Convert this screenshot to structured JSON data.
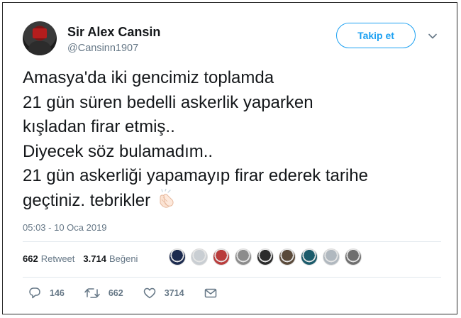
{
  "user": {
    "display_name": "Sir Alex Cansin",
    "handle": "@Cansinn1907"
  },
  "header": {
    "follow_label": "Takip et",
    "menu_icon": "chevron-down-icon"
  },
  "tweet": {
    "lines": [
      "Amasya'da iki gencimiz toplamda",
      "21 gün süren bedelli askerlik yaparken",
      "kışladan firar etmiş..",
      "Diyecek söz bulamadım..",
      "21 gün askerliği yapamayıp firar ederek tarihe",
      "geçtiniz. tebrikler"
    ],
    "emoji": "clapping-hands-icon",
    "timestamp": "05:03 - 10 Oca 2019"
  },
  "stats": {
    "retweet_count": "662",
    "retweet_label": "Retweet",
    "like_count": "3.714",
    "like_label": "Beğeni",
    "liker_colors": [
      "#1c2b4f",
      "#c9ced3",
      "#b93c3c",
      "#8c8c8c",
      "#2b2b2b",
      "#5a4a3a",
      "#1b5b6b",
      "#b0b8bf",
      "#6f6f6f"
    ]
  },
  "actions": {
    "reply_count": "146",
    "retweet_count": "662",
    "like_count": "3714"
  },
  "colors": {
    "accent": "#1da1f2",
    "muted": "#657786",
    "text": "#14171a",
    "divider": "#e1e8ed"
  }
}
